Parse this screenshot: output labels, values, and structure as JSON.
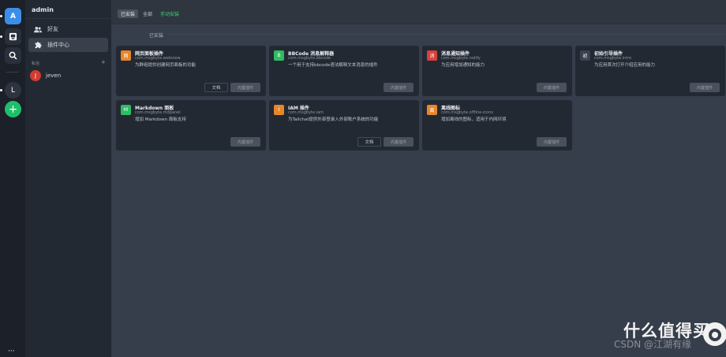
{
  "rail": {
    "avatar_letter": "A",
    "user_letter": "L",
    "add_symbol": "+",
    "more": "···"
  },
  "sidebar": {
    "title": "admin",
    "items": [
      {
        "label": "好友",
        "icon": "friends-icon"
      },
      {
        "label": "插件中心",
        "icon": "puzzle-icon",
        "active": true
      }
    ],
    "section_label": "私信",
    "section_add": "+",
    "dm_user": {
      "initial": "J",
      "name": "jeven",
      "color": "#d33b2f"
    }
  },
  "tabs": [
    {
      "label": "已安装",
      "active": true
    },
    {
      "label": "全部"
    },
    {
      "label": "手动安装",
      "color": "#3fcf7c"
    }
  ],
  "group_label": "已安装",
  "doc_label": "文档",
  "builtin_label": "内置插件",
  "plugins": [
    {
      "icon": "网",
      "color": "#e8862a",
      "name": "网页面板插件",
      "id": "com.msgbyte.webview",
      "desc": "为群组提供创建网页面板的功能",
      "has_doc": true
    },
    {
      "icon": "B",
      "color": "#2ebd63",
      "name": "BBCode 消息解释器",
      "id": "com.msgbyte.bbcode",
      "desc": "一个用于支持bbcode语法解释文本消息的插件",
      "has_doc": false
    },
    {
      "icon": "消",
      "color": "#d8423a",
      "name": "消息通知插件",
      "id": "com.msgbyte.notify",
      "desc": "为应用增加通知的能力",
      "has_doc": false
    },
    {
      "icon": "初",
      "color": "#3a4150",
      "name": "初始引导插件",
      "id": "com.msgbyte.intro",
      "desc": "为应用首次打开介绍应用的能力",
      "has_doc": false
    },
    {
      "icon": "M",
      "color": "#2ebd63",
      "name": "Markdown 面板",
      "id": "com.msgbyte.mdpanel",
      "desc": "增加 Markdown 面板支持",
      "has_doc": false
    },
    {
      "icon": "I",
      "color": "#e8862a",
      "name": "IAM 插件",
      "id": "com.msgbyte.iam",
      "desc": "为Tailchat提供外部登录入外部账户系统的功能",
      "has_doc": true
    },
    {
      "icon": "离",
      "color": "#e8862a",
      "name": "离线图标",
      "id": "com.msgbyte.offline-icons",
      "desc": "增加离线的图标，适用于内网环境",
      "has_doc": false
    }
  ],
  "watermark": {
    "text": "什么值得买",
    "csdn": "CSDN @江湖有缘"
  }
}
